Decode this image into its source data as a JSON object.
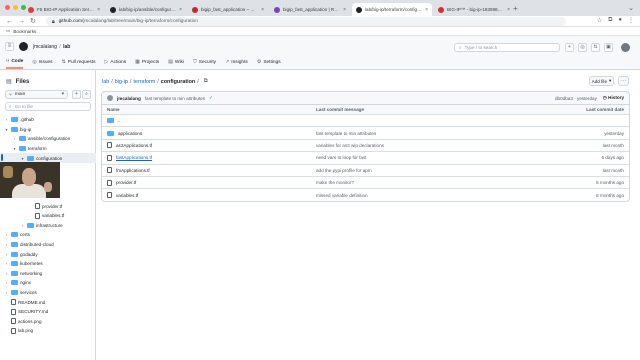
{
  "browser": {
    "tabs": [
      {
        "title": "F5 BIG-IP Application Servic...",
        "color": "#e53935",
        "active": false
      },
      {
        "title": "lab/big-ip/ansible/configuratio...",
        "color": "#1f2328",
        "active": false
      },
      {
        "title": "bigip_fast_application – Mana...",
        "color": "#c62828",
        "active": false
      },
      {
        "title": "bigip_fast_application | Resou...",
        "color": "#7b42bc",
        "active": false
      },
      {
        "title": "lab/big-ip/terraform/configura...",
        "color": "#1f2328",
        "active": true
      },
      {
        "title": "BIG-IP™ - big-ip-19308875.dns...",
        "color": "#d32f2f",
        "active": false
      }
    ],
    "url_domain": "github.com",
    "url_path": "/jmcalalang/lab/tree/main/big-ip/terraform/configuration",
    "bookmarks_label": "Bookmarks"
  },
  "github": {
    "owner": "jmcalalang",
    "repo": "lab",
    "search_placeholder": "Type / to search",
    "nav": [
      {
        "label": "Code",
        "icon": "code-icon",
        "active": true
      },
      {
        "label": "Issues",
        "icon": "issues-icon",
        "active": false
      },
      {
        "label": "Pull requests",
        "icon": "pull-request-icon",
        "active": false
      },
      {
        "label": "Actions",
        "icon": "actions-icon",
        "active": false
      },
      {
        "label": "Projects",
        "icon": "projects-icon",
        "active": false
      },
      {
        "label": "Wiki",
        "icon": "wiki-icon",
        "active": false
      },
      {
        "label": "Security",
        "icon": "shield-icon",
        "active": false
      },
      {
        "label": "Insights",
        "icon": "graph-icon",
        "active": false
      },
      {
        "label": "Settings",
        "icon": "gear-icon",
        "active": false
      }
    ]
  },
  "sidebar": {
    "title": "Files",
    "branch": "main",
    "goto_placeholder": "Go to file",
    "tree": [
      {
        "label": ".github",
        "type": "folder",
        "depth": 0,
        "expanded": false
      },
      {
        "label": "big-ip",
        "type": "folder",
        "depth": 0,
        "expanded": true
      },
      {
        "label": "ansible/configuration",
        "type": "folder",
        "depth": 1,
        "expanded": false
      },
      {
        "label": "terraform",
        "type": "folder",
        "depth": 1,
        "expanded": true
      },
      {
        "label": "configuration",
        "type": "folder",
        "depth": 2,
        "expanded": true,
        "selected": true
      },
      {
        "label": "",
        "type": "hidden",
        "depth": 3
      },
      {
        "label": "",
        "type": "hidden",
        "depth": 3
      },
      {
        "label": "",
        "type": "hidden",
        "depth": 3
      },
      {
        "label": "",
        "type": "hidden",
        "depth": 3
      },
      {
        "label": "provider.tf",
        "type": "file",
        "depth": 3
      },
      {
        "label": "variables.tf",
        "type": "file",
        "depth": 3
      },
      {
        "label": "infrastructure",
        "type": "folder",
        "depth": 2,
        "expanded": false
      },
      {
        "label": "certs",
        "type": "folder",
        "depth": 0,
        "expanded": false
      },
      {
        "label": "distributed-cloud",
        "type": "folder",
        "depth": 0,
        "expanded": false
      },
      {
        "label": "godaddy",
        "type": "folder",
        "depth": 0,
        "expanded": false
      },
      {
        "label": "kubernetes",
        "type": "folder",
        "depth": 0,
        "expanded": false
      },
      {
        "label": "networking",
        "type": "folder",
        "depth": 0,
        "expanded": false
      },
      {
        "label": "nginx",
        "type": "folder",
        "depth": 0,
        "expanded": false
      },
      {
        "label": "services",
        "type": "folder",
        "depth": 0,
        "expanded": false
      },
      {
        "label": "README.md",
        "type": "file",
        "depth": 0
      },
      {
        "label": "SECURITY.md",
        "type": "file",
        "depth": 0
      },
      {
        "label": "actions.png",
        "type": "file",
        "depth": 0
      },
      {
        "label": "lab.png",
        "type": "file",
        "depth": 0
      }
    ]
  },
  "main": {
    "path": [
      "lab",
      "big-ip",
      "terraform"
    ],
    "current": "configuration",
    "add_file": "Add file",
    "commit": {
      "user": "jmcalalang",
      "message": "fast template to min attributes",
      "hash": "db0dba3 · yesterday",
      "history": "History"
    },
    "columns": [
      "Name",
      "Last commit message",
      "Last commit date"
    ],
    "parent": "..",
    "rows": [
      {
        "name": "applications",
        "type": "folder",
        "message": "fast template to min attributes",
        "date": "yesterday",
        "link": false
      },
      {
        "name": "as3Applications.tf",
        "type": "file",
        "message": "variables for as3 wip declarations",
        "date": "last month",
        "link": false
      },
      {
        "name": "fastApplications.tf",
        "type": "file",
        "message": "need vars to loop for fast",
        "date": "6 days ago",
        "link": true
      },
      {
        "name": "fmApplications.tf",
        "type": "file",
        "message": "add the pypi profile for apm",
        "date": "last month",
        "link": false
      },
      {
        "name": "provider.tf",
        "type": "file",
        "message": "make the monitor?",
        "date": "5 months ago",
        "link": false
      },
      {
        "name": "variables.tf",
        "type": "file",
        "message": "missed variable definition",
        "date": "8 months ago",
        "link": false
      }
    ]
  }
}
